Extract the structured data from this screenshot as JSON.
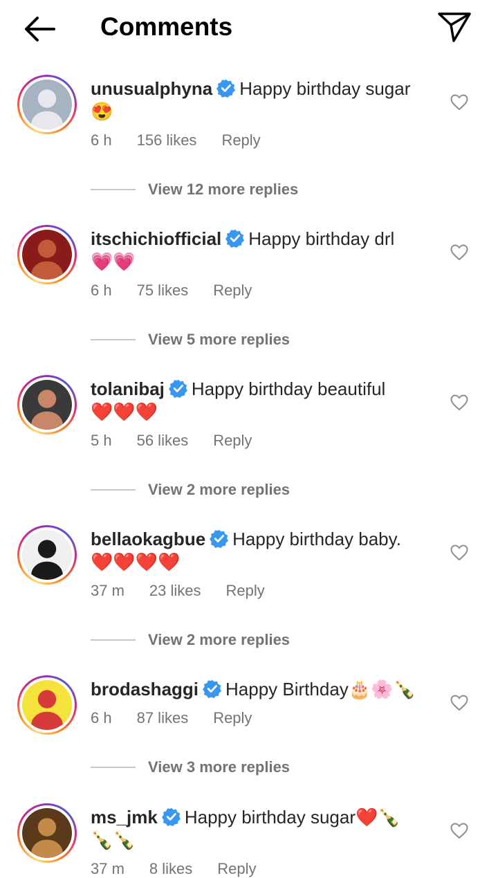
{
  "header": {
    "title": "Comments",
    "back_icon": "arrow-left-icon",
    "share_icon": "paper-plane-icon"
  },
  "colors": {
    "verified": "#3897f0",
    "secondary_text": "#737373",
    "primary_text": "#262626"
  },
  "comments": [
    {
      "username": "unusualphyna",
      "text_line1": "Happy birthday sugar",
      "text_line2": "😍",
      "time": "6 h",
      "likes": "156 likes",
      "reply": "Reply",
      "view_replies": "View 12 more replies",
      "avatar_colors": [
        "#a8b3c2",
        "#e8e8ee"
      ]
    },
    {
      "username": "itschichiofficial",
      "text_line1": "Happy birthday drl",
      "text_line2": "💗💗",
      "time": "6 h",
      "likes": "75 likes",
      "reply": "Reply",
      "view_replies": "View 5 more replies",
      "avatar_colors": [
        "#8b1a1a",
        "#c25b3a"
      ]
    },
    {
      "username": "tolanibaj",
      "text_line1": "Happy birthday beautiful",
      "text_line2": "❤️❤️❤️",
      "time": "5 h",
      "likes": "56 likes",
      "reply": "Reply",
      "view_replies": "View 2 more replies",
      "avatar_colors": [
        "#3a3a3a",
        "#c9876a"
      ]
    },
    {
      "username": "bellaokagbue",
      "text_line1": "Happy birthday baby.",
      "text_line2": "❤️❤️❤️❤️",
      "time": "37 m",
      "likes": "23 likes",
      "reply": "Reply",
      "view_replies": "View 2 more replies",
      "avatar_colors": [
        "#f0f0f0",
        "#1a1a1a"
      ]
    },
    {
      "username": "brodashaggi",
      "text_line1": "Happy Birthday🎂🌸🍾",
      "text_line2": "",
      "time": "6 h",
      "likes": "87 likes",
      "reply": "Reply",
      "view_replies": "View 3 more replies",
      "avatar_colors": [
        "#f5e23a",
        "#d63a3a"
      ]
    },
    {
      "username": "ms_jmk",
      "text_line1": "Happy birthday sugar❤️🍾",
      "text_line2": "🍾🍾",
      "time": "37 m",
      "likes": "8 likes",
      "reply": "Reply",
      "view_replies": "",
      "avatar_colors": [
        "#5a3a1a",
        "#c48a4a"
      ]
    }
  ]
}
